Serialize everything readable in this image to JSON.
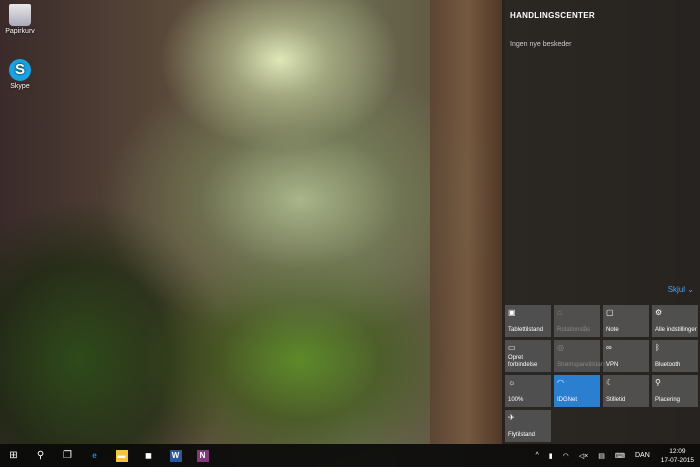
{
  "desktop": {
    "icons": [
      {
        "label": "Papirkurv",
        "icon": "recycle-bin-icon"
      },
      {
        "label": "Skype",
        "icon": "skype-icon",
        "glyph": "S"
      }
    ]
  },
  "action_center": {
    "title": "HANDLINGSCENTER",
    "no_notifications": "Ingen nye beskeder",
    "hide_label": "Skjul",
    "tiles": [
      {
        "label": "Tablettilstand",
        "icon": "tablet-mode-icon",
        "glyph": "▣",
        "state": "normal"
      },
      {
        "label": "Rotationslås",
        "icon": "rotation-lock-icon",
        "glyph": "⌂",
        "state": "disabled"
      },
      {
        "label": "Note",
        "icon": "note-icon",
        "glyph": "▢",
        "state": "normal"
      },
      {
        "label": "Alle indstillinger",
        "icon": "settings-gear-icon",
        "glyph": "⚙",
        "state": "normal"
      },
      {
        "label": "Opret forbindelse",
        "icon": "connect-icon",
        "glyph": "▭",
        "state": "normal"
      },
      {
        "label": "Strømsparetilstand",
        "icon": "battery-saver-icon",
        "glyph": "◎",
        "state": "disabled"
      },
      {
        "label": "VPN",
        "icon": "vpn-icon",
        "glyph": "∞",
        "state": "normal"
      },
      {
        "label": "Bluetooth",
        "icon": "bluetooth-icon",
        "glyph": "ᛒ",
        "state": "normal"
      },
      {
        "label": "100%",
        "icon": "brightness-icon",
        "glyph": "☼",
        "state": "normal"
      },
      {
        "label": "IDGNet",
        "icon": "wifi-icon",
        "glyph": "◠",
        "state": "active"
      },
      {
        "label": "Stilletid",
        "icon": "quiet-hours-moon-icon",
        "glyph": "☾",
        "state": "normal"
      },
      {
        "label": "Placering",
        "icon": "location-icon",
        "glyph": "⚲",
        "state": "normal"
      },
      {
        "label": "Flytilstand",
        "icon": "airplane-mode-icon",
        "glyph": "✈",
        "state": "normal"
      }
    ]
  },
  "taskbar": {
    "start_glyph": "⊞",
    "search_glyph": "⚲",
    "taskview_glyph": "❐",
    "apps": [
      {
        "name": "edge",
        "glyph": "e",
        "color": "#1e88e5"
      },
      {
        "name": "file-explorer",
        "glyph": "▬",
        "color": "#f5c242"
      },
      {
        "name": "store",
        "glyph": "◼",
        "color": "#ffffff"
      },
      {
        "name": "word",
        "glyph": "W",
        "color": "#2b579a"
      },
      {
        "name": "onenote",
        "glyph": "N",
        "color": "#80397b"
      }
    ],
    "tray_glyphs": [
      "^",
      "▮",
      "◠",
      "◁×",
      "▤",
      "⌨"
    ],
    "language": "DAN",
    "time": "12:09",
    "date": "17-07-2015"
  }
}
